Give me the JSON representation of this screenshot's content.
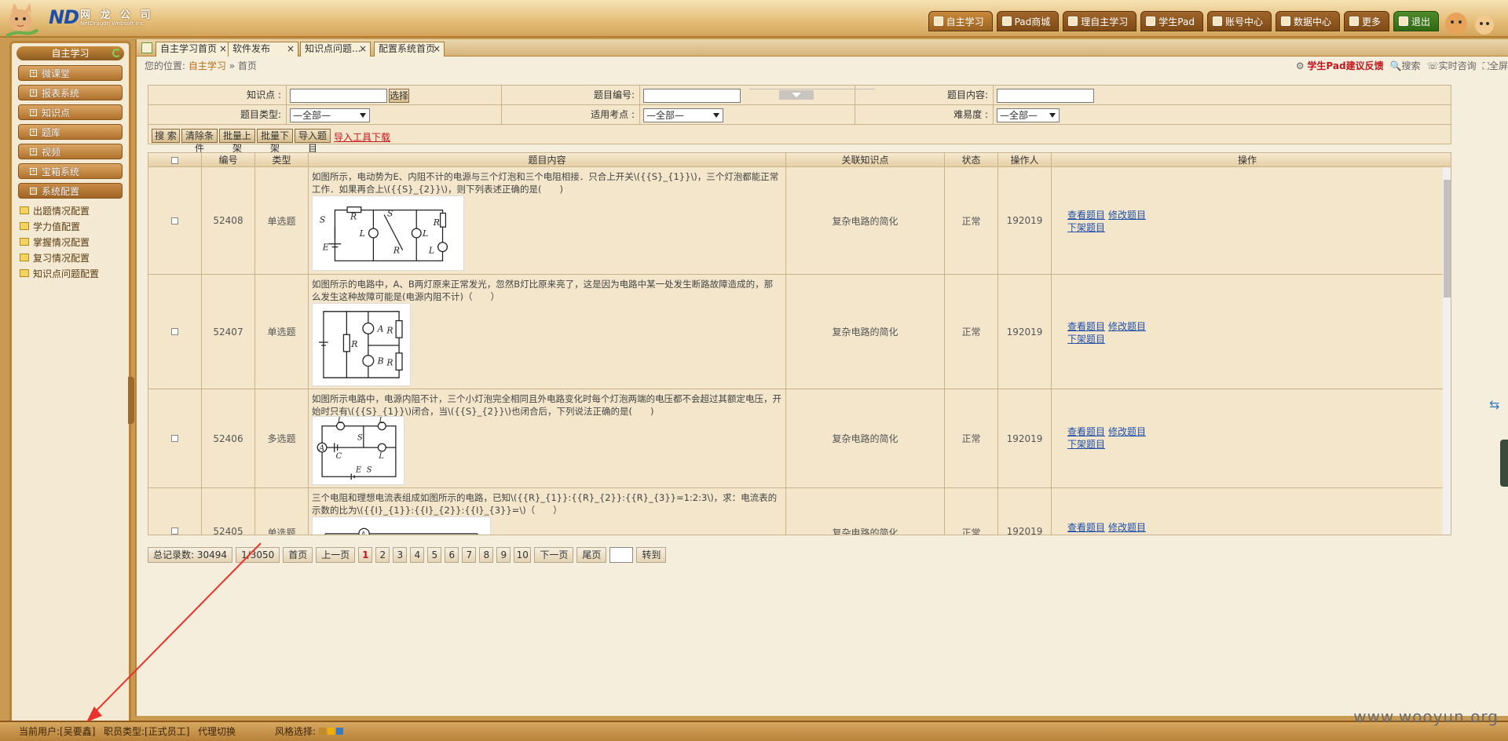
{
  "company": {
    "brand": "ND",
    "name_cn": "网 龙 公 司",
    "name_en": "NetDragon Websoft Inc."
  },
  "topnav": [
    {
      "label": "自主学习",
      "active": true
    },
    {
      "label": "Pad商城"
    },
    {
      "label": "理自主学习"
    },
    {
      "label": "学生Pad"
    },
    {
      "label": "账号中心"
    },
    {
      "label": "数据中心"
    },
    {
      "label": "更多"
    },
    {
      "label": "退出",
      "exit": true
    }
  ],
  "sidebar": {
    "title": "自主学习",
    "menus": [
      "微课堂",
      "报表系统",
      "知识点",
      "题库",
      "视频",
      "宝箱系统",
      "系统配置"
    ],
    "sub_items": [
      "出题情况配置",
      "学力值配置",
      "掌握情况配置",
      "复习情况配置",
      "知识点问题配置"
    ]
  },
  "tabs": [
    {
      "label": "自主学习首页"
    },
    {
      "label": "软件发布"
    },
    {
      "label": "知识点问题..."
    },
    {
      "label": "配置系统首页"
    }
  ],
  "breadcrumb": {
    "prefix": "您的位置:",
    "link": "自主学习",
    "sep": "»",
    "current": "首页"
  },
  "toplinks": {
    "feedback": "学生Pad建议反馈",
    "search": "搜索",
    "consult": "实时咨询",
    "fullscreen": "全屏"
  },
  "search": {
    "knowledge_label": "知识点 :",
    "select_btn": "选择",
    "qid_label": "题目编号:",
    "content_label": "题目内容:",
    "type_label": "题目类型:",
    "type_value": "—全部—",
    "exam_label": "适用考点 :",
    "exam_value": "—全部—",
    "difficulty_label": "难易度 :",
    "difficulty_value": "—全部—"
  },
  "toolbar": {
    "search": "搜  索",
    "clear": "清除条件",
    "batch_up": "批量上架",
    "batch_down": "批量下架",
    "import": "导入题目",
    "download": "导入工具下载"
  },
  "table": {
    "headers": [
      "编号",
      "类型",
      "题目内容",
      "关联知识点",
      "状态",
      "操作人",
      "操作"
    ],
    "rows": [
      {
        "id": "52408",
        "type": "单选题",
        "content": "如图所示，电动势为E、内阻不计的电源与三个灯泡和三个电阻相接．只合上开关\\({{S}_{1}}\\)，三个灯泡都能正常工作．如果再合上\\({{S}_{2}}\\)，则下列表述正确的是(　　)",
        "knowledge": "复杂电路的简化",
        "status": "正常",
        "operator": "192019",
        "ops": [
          "查看题目",
          "修改题目",
          "下架题目"
        ]
      },
      {
        "id": "52407",
        "type": "单选题",
        "content": "如图所示的电路中，A、B两灯原来正常发光，忽然B灯比原来亮了，这是因为电路中某一处发生断路故障造成的，那么发生这种故障可能是(电源内阻不计)（　　）",
        "knowledge": "复杂电路的简化",
        "status": "正常",
        "operator": "192019",
        "ops": [
          "查看题目",
          "修改题目",
          "下架题目"
        ]
      },
      {
        "id": "52406",
        "type": "多选题",
        "content": "如图所示电路中，电源内阻不计，三个小灯泡完全相同且外电路变化时每个灯泡两端的电压都不会超过其额定电压，开始时只有\\({{S}_{1}}\\)闭合，当\\({{S}_{2}}\\)也闭合后，下列说法正确的是(　　)",
        "knowledge": "复杂电路的简化",
        "status": "正常",
        "operator": "192019",
        "ops": [
          "查看题目",
          "修改题目",
          "下架题目"
        ]
      },
      {
        "id": "52405",
        "type": "单选题",
        "content": "三个电阻和理想电流表组成如图所示的电路，已知\\({{R}_{1}}:{{R}_{2}}:{{R}_{3}}=1:2:3\\)，求：电流表的示数的比为\\({{I}_{1}}:{{I}_{2}}:{{I}_{3}}=\\)（　　）",
        "knowledge": "复杂电路的简化",
        "status": "正常",
        "operator": "192019",
        "ops": [
          "查看题目",
          "修改题目"
        ]
      }
    ]
  },
  "pager": {
    "total_label": "总记录数:",
    "total": "30494",
    "page_info": "1/3050",
    "first": "首页",
    "prev": "上一页",
    "pages": [
      "1",
      "2",
      "3",
      "4",
      "5",
      "6",
      "7",
      "8",
      "9",
      "10"
    ],
    "next": "下一页",
    "last": "尾页",
    "go": "转到"
  },
  "footer": {
    "user_label": "当前用户:",
    "user": "[吴要鑫]",
    "role_label": "职员类型:",
    "role": "[正式员工]",
    "proxy": "代理切换",
    "style_label": "风格选择:",
    "style_colors": [
      "#c08a2a",
      "#f0b000",
      "#3a78c0"
    ]
  },
  "watermark": "www.wooyun.org"
}
